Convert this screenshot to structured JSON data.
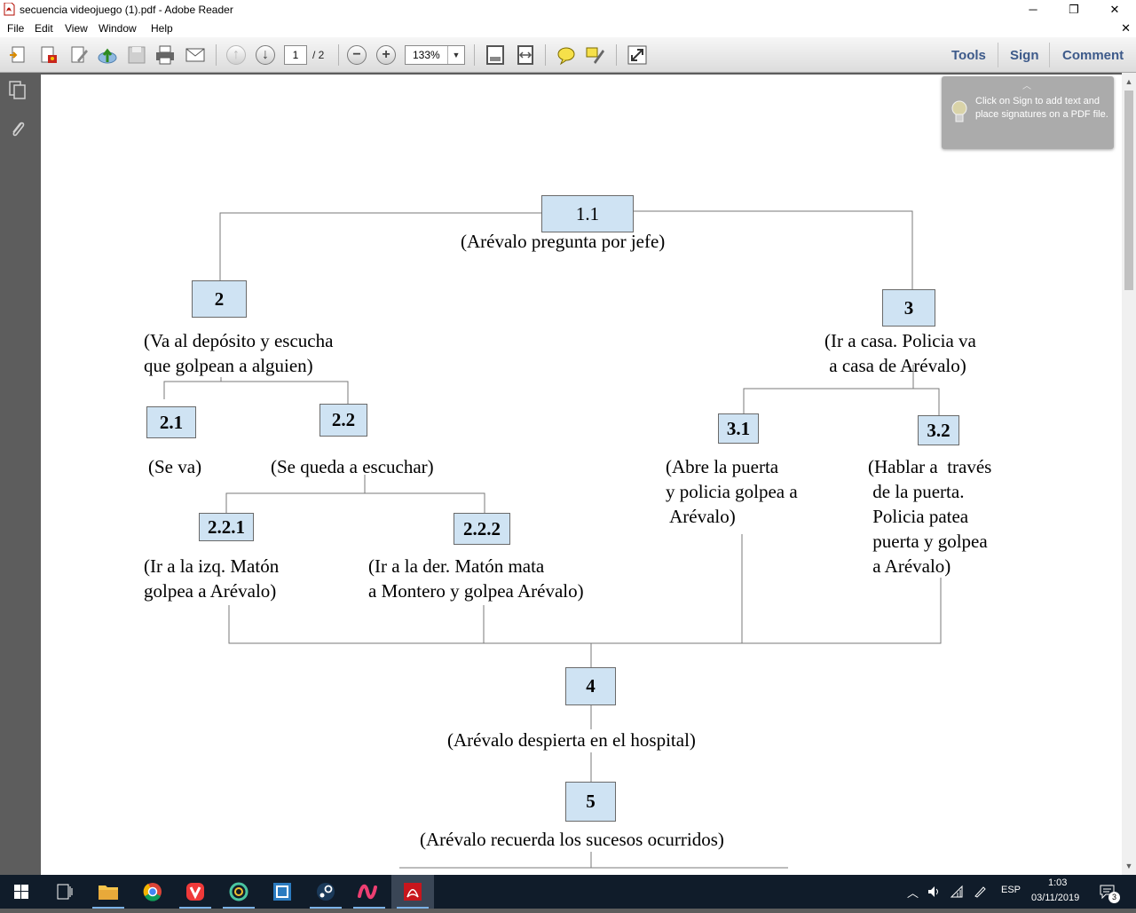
{
  "window": {
    "title": "secuencia videojuego (1).pdf - Adobe Reader",
    "minimize": "─",
    "restore": "❐",
    "close": "✕"
  },
  "menu": {
    "items": [
      "File",
      "Edit",
      "View",
      "Window",
      "Help"
    ],
    "close": "✕"
  },
  "toolbar": {
    "page_current": "1",
    "page_total": "/ 2",
    "zoom": "133%",
    "right_links": [
      "Tools",
      "Sign",
      "Comment"
    ],
    "icons": [
      "create-pdf-icon",
      "export-pdf-icon",
      "edit-icon",
      "upload-icon",
      "save-icon",
      "print-icon",
      "email-icon",
      "previous-page-icon",
      "next-page-icon",
      "zoom-out-icon",
      "zoom-in-icon",
      "fit-page-icon",
      "fit-width-icon",
      "sticky-note-icon",
      "highlight-icon",
      "fullscreen-icon"
    ]
  },
  "left_pane": {
    "icons": [
      "page-thumbnails-icon",
      "attachments-icon"
    ]
  },
  "tooltip": {
    "text": "Click on Sign to add text and place signatures on a PDF file."
  },
  "diagram": {
    "nodes": {
      "n1_1": {
        "label": "1.1",
        "caption": "(Arévalo pregunta por jefe)"
      },
      "n2": {
        "label": "2",
        "caption": "(Va al depósito y escucha\nque golpean a alguien)"
      },
      "n3": {
        "label": "3",
        "caption": "(Ir a casa. Policia va\n a casa de Arévalo)"
      },
      "n2_1": {
        "label": "2.1",
        "caption": "(Se va)"
      },
      "n2_2": {
        "label": "2.2",
        "caption": "(Se queda a escuchar)"
      },
      "n3_1": {
        "label": "3.1",
        "caption": "(Abre la puerta\ny policia golpea a\n Arévalo)"
      },
      "n3_2": {
        "label": "3.2",
        "caption": "(Hablar a  través\n de la puerta.\n Policia patea\n puerta y golpea\n a Arévalo)"
      },
      "n2_2_1": {
        "label": "2.2.1",
        "caption": "(Ir a la izq. Matón\ngolpea a Arévalo)"
      },
      "n2_2_2": {
        "label": "2.2.2",
        "caption": "(Ir a la der. Matón mata\na Montero y golpea Arévalo)"
      },
      "n4": {
        "label": "4",
        "caption": "(Arévalo despierta en el hospital)"
      },
      "n5": {
        "label": "5",
        "caption": "(Arévalo recuerda los sucesos ocurridos)"
      }
    }
  },
  "taskbar": {
    "apps": [
      "windows-start-icon",
      "task-view-icon",
      "file-explorer-icon",
      "chrome-icon",
      "vivaldi-icon",
      "ring-app-icon",
      "square-app-icon",
      "steam-icon",
      "wave-app-icon",
      "adobe-reader-icon"
    ],
    "language": "ESP",
    "time": "1:03",
    "date": "03/11/2019",
    "notifications": "3"
  }
}
